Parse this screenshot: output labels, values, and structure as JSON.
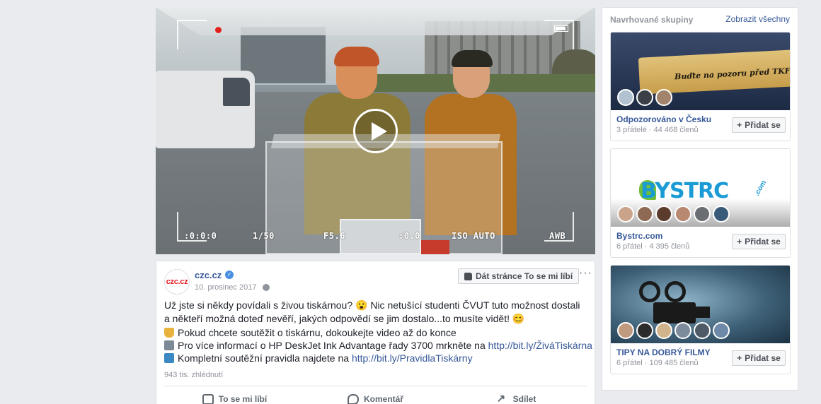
{
  "video": {
    "rec_overlay": {
      "timecode": ":0:0:0",
      "shots": "1/50",
      "aperture": "F5.6",
      "exposure": ":0.0",
      "iso": "ISO AUTO",
      "wb": "AWB"
    },
    "play_state": "paused"
  },
  "post": {
    "page_name": "czc.cz",
    "avatar_text": "czc.cz",
    "verified": true,
    "date": "10. prosinec 2017",
    "like_page_label": "Dát stránce To se mi líbí",
    "text": "Už jste si někdy povídali s živou tiskárnou? 😮 Nic netušící studenti ČVUT tuto možnost dostali a někteří možná doteď nevěří, jakých odpovědí se jim dostalo...to musíte vidět! 😊",
    "line1": "Pokud chcete soutěžit o tiskárnu, dokoukejte video až do konce",
    "line2_text": "Pro více informací o HP DeskJet Ink Advantage řady 3700 mrkněte na ",
    "line2_link": "http://bit.ly/ŽiváTiskárna",
    "line3_text": "Kompletní soutěžní pravidla najdete na ",
    "line3_link": "http://bit.ly/PravidlaTiskárny",
    "views": "943 tis. zhlédnutí",
    "actions": {
      "like": "To se mi líbí",
      "comment": "Komentář",
      "share": "Sdílet"
    }
  },
  "sidebar": {
    "title": "Navrhované skupiny",
    "see_all": "Zobrazit všechny",
    "groups": [
      {
        "name": "Odpozorováno v Česku",
        "stats": "3 přátelé · 44 468 členů",
        "join_label": "Přidat se",
        "cover_text": "Buďte na pozoru před TKF."
      },
      {
        "name": "Bystrc.com",
        "stats": "6 přátel · 4 395 členů",
        "join_label": "Přidat se",
        "cover_text": "BYSTRC",
        "cover_suffix": ".com"
      },
      {
        "name": "TIPY NA DOBRÝ FILMY",
        "stats": "6 přátel · 109 485 členů",
        "join_label": "Přidat se"
      }
    ]
  },
  "colors": {
    "link": "#365899",
    "muted": "#90949c",
    "brand_red": "#e31e24",
    "background": "#e9ebee"
  }
}
